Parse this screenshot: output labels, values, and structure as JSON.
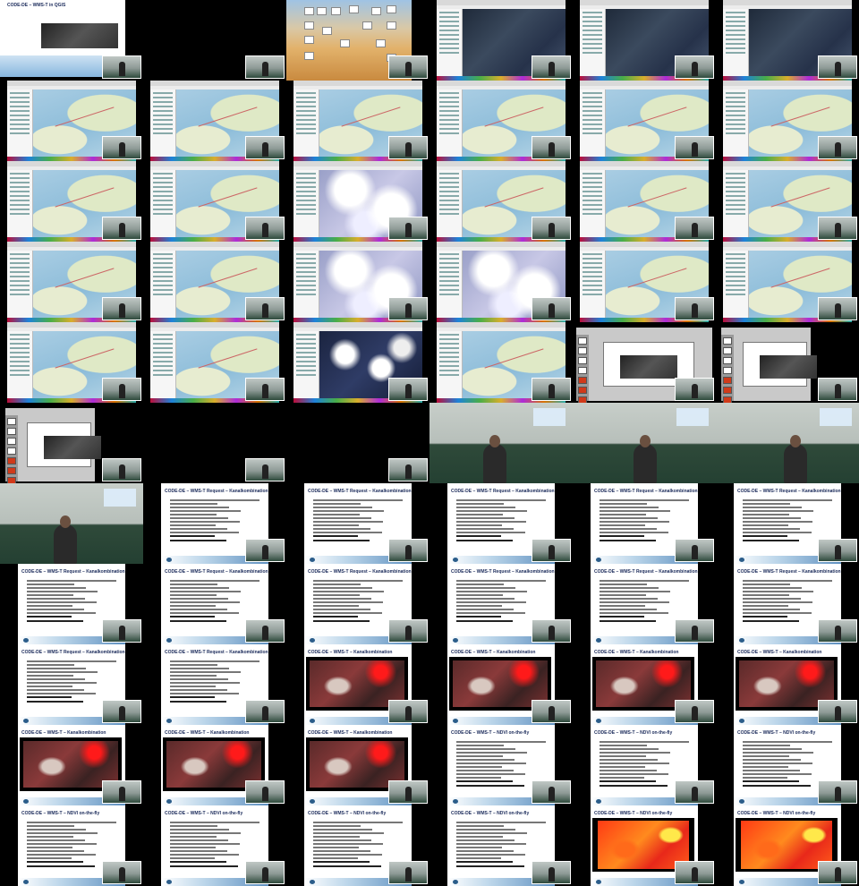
{
  "screen": {
    "background": "#000000"
  },
  "texts": {
    "qgis_title": "CODE-DE – WMS-T in QGIS",
    "wms_kanal_title": "CODE-DE – WMS-T Request – Kanalkombination",
    "wmst_kanal_title": "CODE-DE – WMS-T – Kanalkombination",
    "ndvi_title": "CODE-DE – WMS-T – NDVI on-the-fly"
  },
  "tiles": [
    {
      "type": "qgis",
      "title_key": "qgis_title"
    },
    {
      "type": "black"
    },
    {
      "type": "desktop"
    },
    {
      "type": "sat"
    },
    {
      "type": "sat"
    },
    {
      "type": "sat"
    },
    {
      "type": "map"
    },
    {
      "type": "map"
    },
    {
      "type": "map"
    },
    {
      "type": "map"
    },
    {
      "type": "map"
    },
    {
      "type": "map"
    },
    {
      "type": "map"
    },
    {
      "type": "map"
    },
    {
      "type": "cloud"
    },
    {
      "type": "map"
    },
    {
      "type": "map"
    },
    {
      "type": "map"
    },
    {
      "type": "map"
    },
    {
      "type": "map"
    },
    {
      "type": "cloud"
    },
    {
      "type": "cloud"
    },
    {
      "type": "map"
    },
    {
      "type": "map"
    },
    {
      "type": "map"
    },
    {
      "type": "map"
    },
    {
      "type": "cloudd"
    },
    {
      "type": "map"
    },
    {
      "type": "ppt"
    },
    {
      "type": "ppt2"
    },
    {
      "type": "ppt2"
    },
    {
      "type": "blackcam"
    },
    {
      "type": "black"
    },
    {
      "type": "room",
      "people": 1
    },
    {
      "type": "room",
      "people": 1
    },
    {
      "type": "room",
      "people": 1
    },
    {
      "type": "room",
      "people": 1
    },
    {
      "type": "slide",
      "title_key": "wms_kanal_title"
    },
    {
      "type": "slide",
      "title_key": "wms_kanal_title"
    },
    {
      "type": "slide",
      "title_key": "wms_kanal_title"
    },
    {
      "type": "slide",
      "title_key": "wms_kanal_title"
    },
    {
      "type": "slide",
      "title_key": "wms_kanal_title"
    },
    {
      "type": "slide",
      "title_key": "wms_kanal_title"
    },
    {
      "type": "slide",
      "title_key": "wms_kanal_title"
    },
    {
      "type": "slide",
      "title_key": "wms_kanal_title"
    },
    {
      "type": "slide",
      "title_key": "wms_kanal_title"
    },
    {
      "type": "slide",
      "title_key": "wms_kanal_title"
    },
    {
      "type": "slide",
      "title_key": "wms_kanal_title"
    },
    {
      "type": "slide",
      "title_key": "wms_kanal_title"
    },
    {
      "type": "slide",
      "title_key": "wms_kanal_title"
    },
    {
      "type": "red",
      "title_key": "wmst_kanal_title"
    },
    {
      "type": "red",
      "title_key": "wmst_kanal_title"
    },
    {
      "type": "red",
      "title_key": "wmst_kanal_title"
    },
    {
      "type": "red",
      "title_key": "wmst_kanal_title"
    },
    {
      "type": "red",
      "title_key": "wmst_kanal_title"
    },
    {
      "type": "red",
      "title_key": "wmst_kanal_title"
    },
    {
      "type": "red",
      "title_key": "wmst_kanal_title"
    },
    {
      "type": "slide",
      "title_key": "ndvi_title"
    },
    {
      "type": "slide",
      "title_key": "ndvi_title"
    },
    {
      "type": "slide",
      "title_key": "ndvi_title"
    },
    {
      "type": "slide",
      "title_key": "ndvi_title"
    },
    {
      "type": "slide",
      "title_key": "ndvi_title"
    },
    {
      "type": "slide",
      "title_key": "ndvi_title"
    },
    {
      "type": "slide",
      "title_key": "ndvi_title"
    },
    {
      "type": "ndvi",
      "title_key": "ndvi_title"
    },
    {
      "type": "ndvi",
      "title_key": "ndvi_title"
    }
  ]
}
